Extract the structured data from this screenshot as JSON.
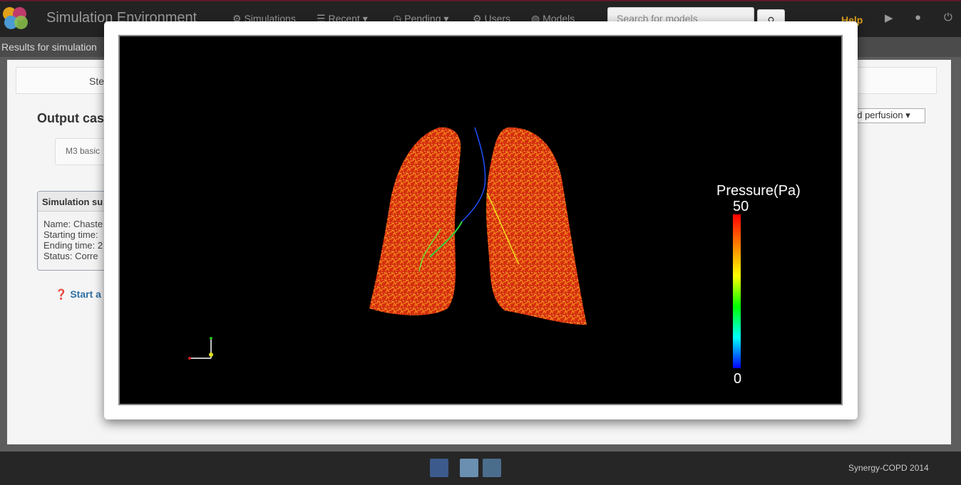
{
  "app": {
    "title": "Simulation Environment",
    "logo_colors": [
      "#e0a21b",
      "#c03a6a",
      "#4a9ad4",
      "#8bc34a"
    ]
  },
  "nav": {
    "items": [
      {
        "label": "Simulations",
        "icon": "gear-icon"
      },
      {
        "label": "Recent",
        "icon": "list-icon"
      },
      {
        "label": "Pending",
        "icon": "clock-icon"
      },
      {
        "label": "Users",
        "icon": "gear-icon"
      },
      {
        "label": "Models",
        "icon": "globe-icon"
      }
    ],
    "search_placeholder": "Search for models",
    "help_label": "Help"
  },
  "breadcrumb": "Results for simulation",
  "page": {
    "tab_label": "Ste",
    "output_title": "Output cas",
    "dropdown_value": "nd perfusion",
    "m3_label": "M3 basic",
    "summary": {
      "title": "Simulation su",
      "lines": [
        "Name: Chaste",
        "Starting time:",
        "Ending time: 2",
        "Status: Corre"
      ]
    },
    "start_link": "Start a t"
  },
  "viewer": {
    "legend_title": "Pressure(Pa)",
    "legend_max": "50",
    "legend_min": "0"
  },
  "footer": {
    "copyright": "Synergy-COPD 2014"
  }
}
